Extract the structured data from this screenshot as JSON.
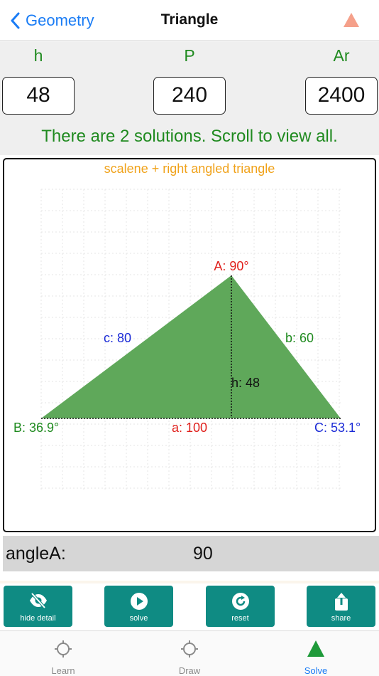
{
  "nav": {
    "back_label": "Geometry",
    "title": "Triangle"
  },
  "inputs": [
    {
      "label": "h",
      "value": "48"
    },
    {
      "label": "P",
      "value": "240"
    },
    {
      "label": "Ar",
      "value": "2400"
    }
  ],
  "message": "There are 2 solutions. Scroll to view all.",
  "drawing": {
    "type_label": "scalene + right angled triangle",
    "vertex_A": "A: 90°",
    "vertex_B": "B: 36.9°",
    "vertex_C": "C: 53.1°",
    "side_a": "a: 100",
    "side_b": "b: 60",
    "side_c": "c: 80",
    "height": "h: 48",
    "colors": {
      "fill": "#5fa85a",
      "vertexA": "#e0201c",
      "vertexB": "#1f8a1f",
      "vertexC": "#1a2ad6",
      "sideA": "#e0201c",
      "sideB": "#1f8a1f",
      "sideC": "#1a2ad6"
    }
  },
  "readout": {
    "key": "angleA:",
    "value": "90"
  },
  "actions": [
    {
      "label": "hide detail",
      "icon": "eye-slash-icon"
    },
    {
      "label": "solve",
      "icon": "play-icon"
    },
    {
      "label": "reset",
      "icon": "refresh-icon"
    },
    {
      "label": "share",
      "icon": "share-icon"
    }
  ],
  "tabs": [
    {
      "label": "Learn",
      "icon": "crosshair-icon"
    },
    {
      "label": "Draw",
      "icon": "crosshair-icon"
    },
    {
      "label": "Solve",
      "icon": "triangle-icon",
      "active": true
    }
  ],
  "theme": {
    "accent": "#1a7cf5",
    "button": "#0f8b83",
    "green": "#1f8a1f"
  }
}
